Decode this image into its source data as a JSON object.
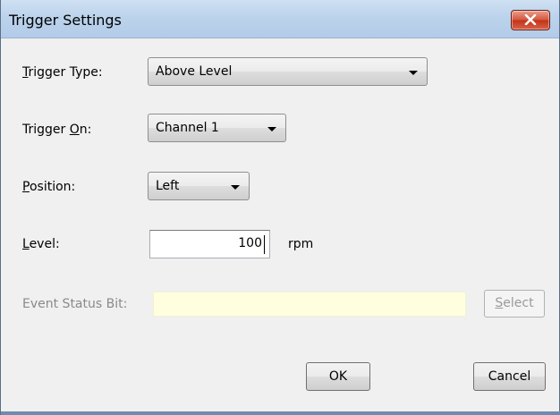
{
  "window": {
    "title": "Trigger Settings",
    "close_icon": "close-icon"
  },
  "fields": {
    "trigger_type": {
      "label_prefix": "",
      "label_mnemonic": "T",
      "label_rest": "rigger Type:",
      "value": "Above Level"
    },
    "trigger_on": {
      "label_prefix": "Trigger ",
      "label_mnemonic": "O",
      "label_rest": "n:",
      "value": "Channel 1"
    },
    "position": {
      "label_prefix": "",
      "label_mnemonic": "P",
      "label_rest": "osition:",
      "value": "Left"
    },
    "level": {
      "label_prefix": "",
      "label_mnemonic": "L",
      "label_rest": "evel:",
      "value": "100",
      "unit": "rpm"
    },
    "event_status_bit": {
      "label": "Event Status Bit:",
      "value": "",
      "select_prefix": "",
      "select_mnemonic": "S",
      "select_rest": "elect"
    }
  },
  "buttons": {
    "ok": "OK",
    "cancel": "Cancel"
  },
  "colors": {
    "titlebar": "#bcd3ec",
    "close_button": "#c3331a",
    "disabled_field": "#ffffe0"
  }
}
